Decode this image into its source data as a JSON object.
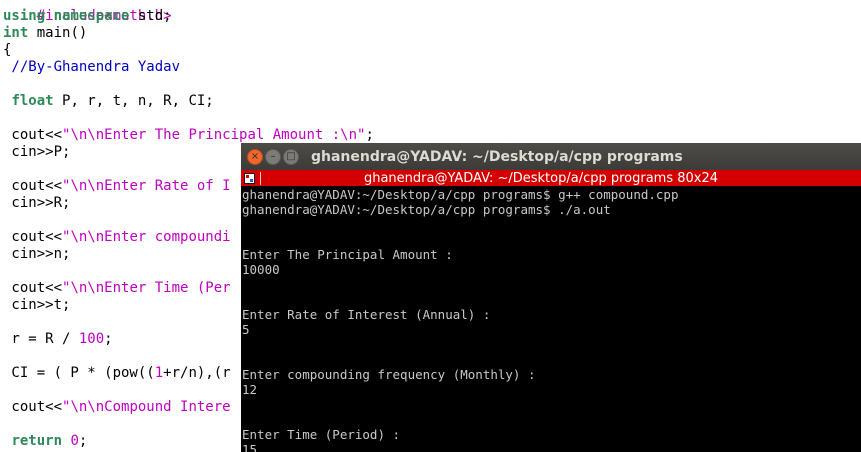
{
  "editor": {
    "lines": {
      "include": "#include<math.h>",
      "using_kw": "using",
      "namespace_kw": "namespace",
      "using_rest": " std;",
      "int_kw": "int",
      "main_rest": " main()",
      "open_brace": "{",
      "comment": " //By-Ghanendra Yadav",
      "float_kw": "float",
      "float_rest": " P, r, t, n, R, CI;",
      "cout1_pre": " cout<<",
      "cout1_str": "\"\\n\\nEnter The Principal Amount :\\n\"",
      "cout1_end": ";",
      "cin1": " cin>>P;",
      "cout2_pre": " cout<<",
      "cout2_str": "\"\\n\\nEnter Rate of I",
      "cin2": " cin>>R;",
      "cout3_pre": " cout<<",
      "cout3_str": "\"\\n\\nEnter compoundi",
      "cin3": " cin>>n;",
      "cout4_pre": " cout<<",
      "cout4_str": "\"\\n\\nEnter Time (Per",
      "cin4": " cin>>t;",
      "assign_pre": " r = R / ",
      "assign_num": "100",
      "assign_end": ";",
      "ci_pre": " CI = ( P * (pow((",
      "ci_num": "1",
      "ci_rest": "+r/n),(r",
      "cout5_pre": " cout<<",
      "cout5_str": "\"\\n\\nCompound Intere",
      "return_kw": "return",
      "return_num": "0",
      "return_end": ";"
    }
  },
  "terminal": {
    "window_title": "ghanendra@YADAV: ~/Desktop/a/cpp programs",
    "tab_title": "ghanendra@YADAV: ~/Desktop/a/cpp programs 80x24",
    "buttons": {
      "close": "×",
      "minimize": "–",
      "maximize": "□"
    },
    "output": [
      "ghanendra@YADAV:~/Desktop/a/cpp programs$ g++ compound.cpp",
      "ghanendra@YADAV:~/Desktop/a/cpp programs$ ./a.out",
      "",
      "",
      "Enter The Principal Amount :",
      "10000",
      "",
      "",
      "Enter Rate of Interest (Annual) :",
      "5",
      "",
      "",
      "Enter compounding frequency (Monthly) :",
      "12",
      "",
      "",
      "Enter Time (Period) :",
      "15"
    ]
  },
  "colors": {
    "terminal_bg": "#000000",
    "terminal_text": "#c8c8c8",
    "tab_bar": "#d40000",
    "titlebar": "#3c3b37",
    "close_button": "#f0662e",
    "keyword": "#2e8b57",
    "string": "#c000c0",
    "comment": "#0000c0"
  }
}
